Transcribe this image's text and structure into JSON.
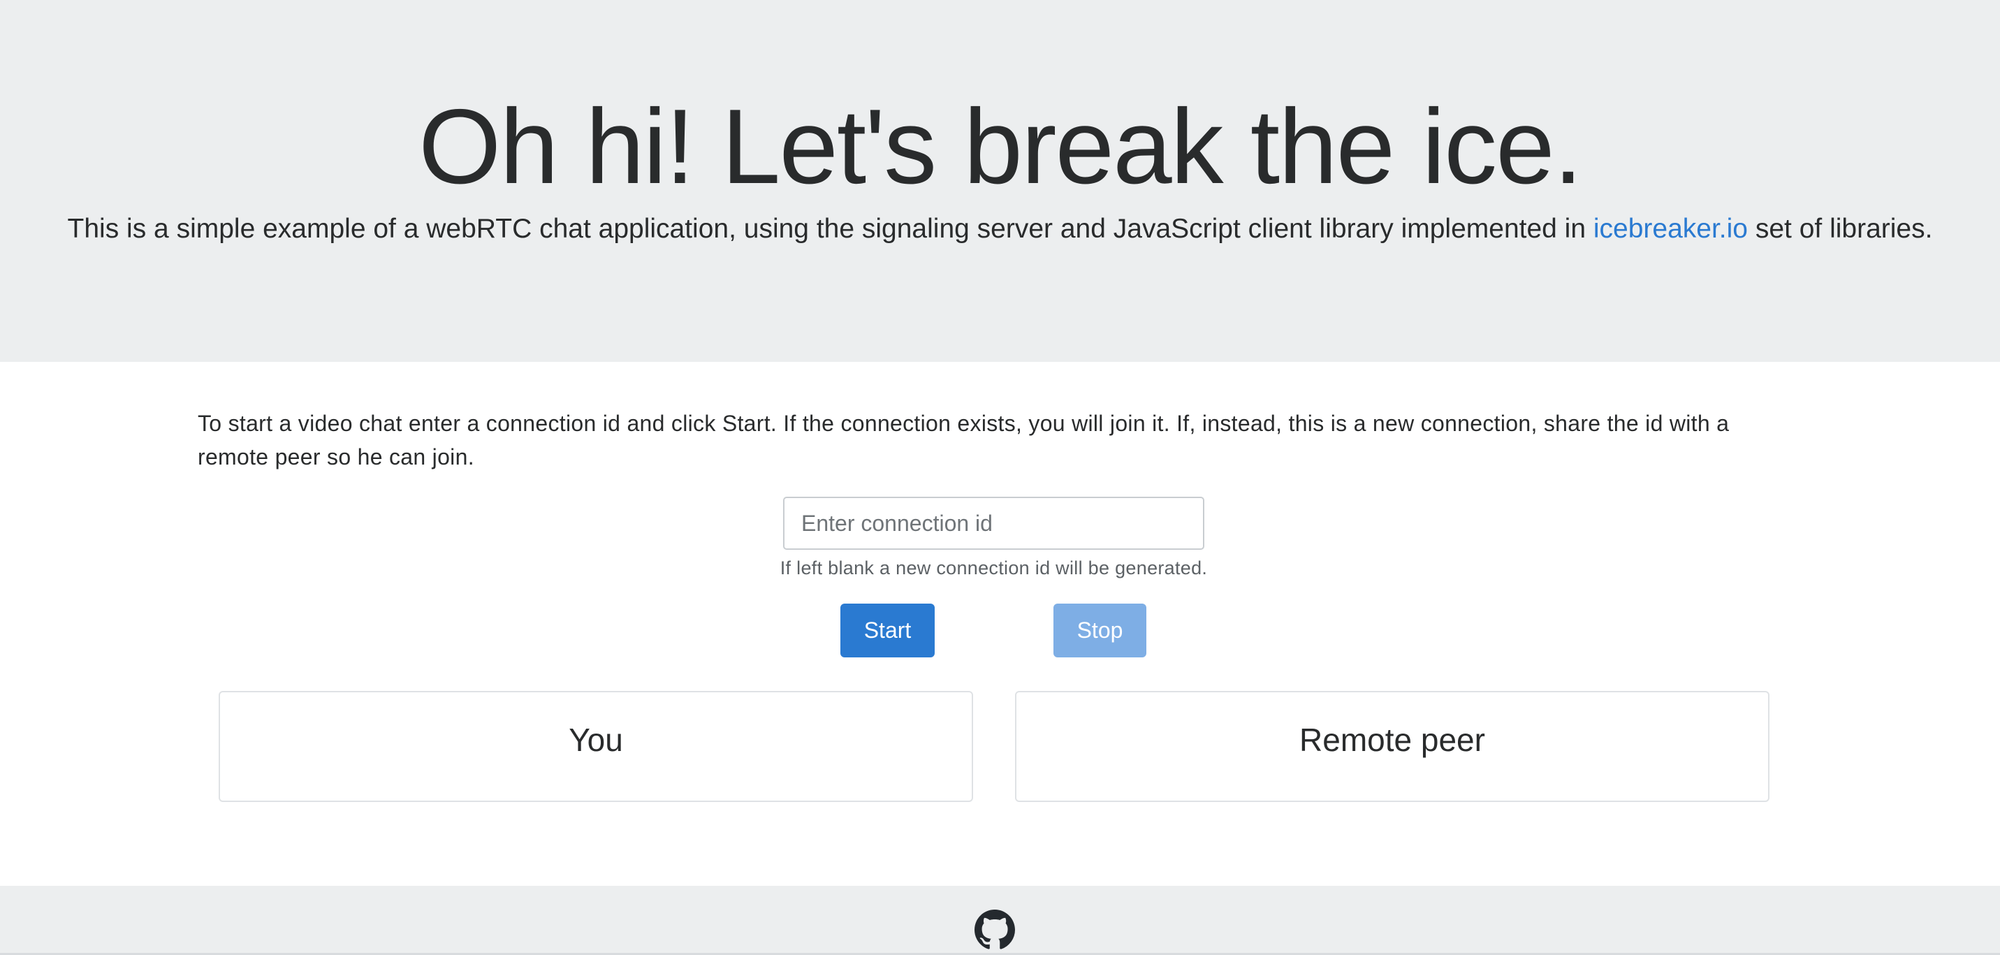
{
  "header": {
    "title": "Oh hi! Let's break the ice.",
    "lead_before": "This is a simple example of a webRTC chat application, using the signaling server and JavaScript client library implemented in ",
    "lead_link": "icebreaker.io",
    "lead_after": " set of libraries."
  },
  "main": {
    "intro": "To start a video chat enter a connection id and click Start. If the connection exists, you will join it. If, instead, this is a new connection, share the id with a remote peer so he can join.",
    "connection_input": {
      "placeholder": "Enter connection id",
      "value": ""
    },
    "help_text": "If left blank a new connection id will be generated.",
    "start_label": "Start",
    "stop_label": "Stop",
    "cards": {
      "local_title": "You",
      "remote_title": "Remote peer"
    }
  },
  "footer": {
    "icon": "github-icon"
  },
  "colors": {
    "jumbotron_bg": "#eceeef",
    "primary": "#2a7ad1",
    "primary_disabled": "#7eaee5",
    "text": "#292b2c"
  }
}
